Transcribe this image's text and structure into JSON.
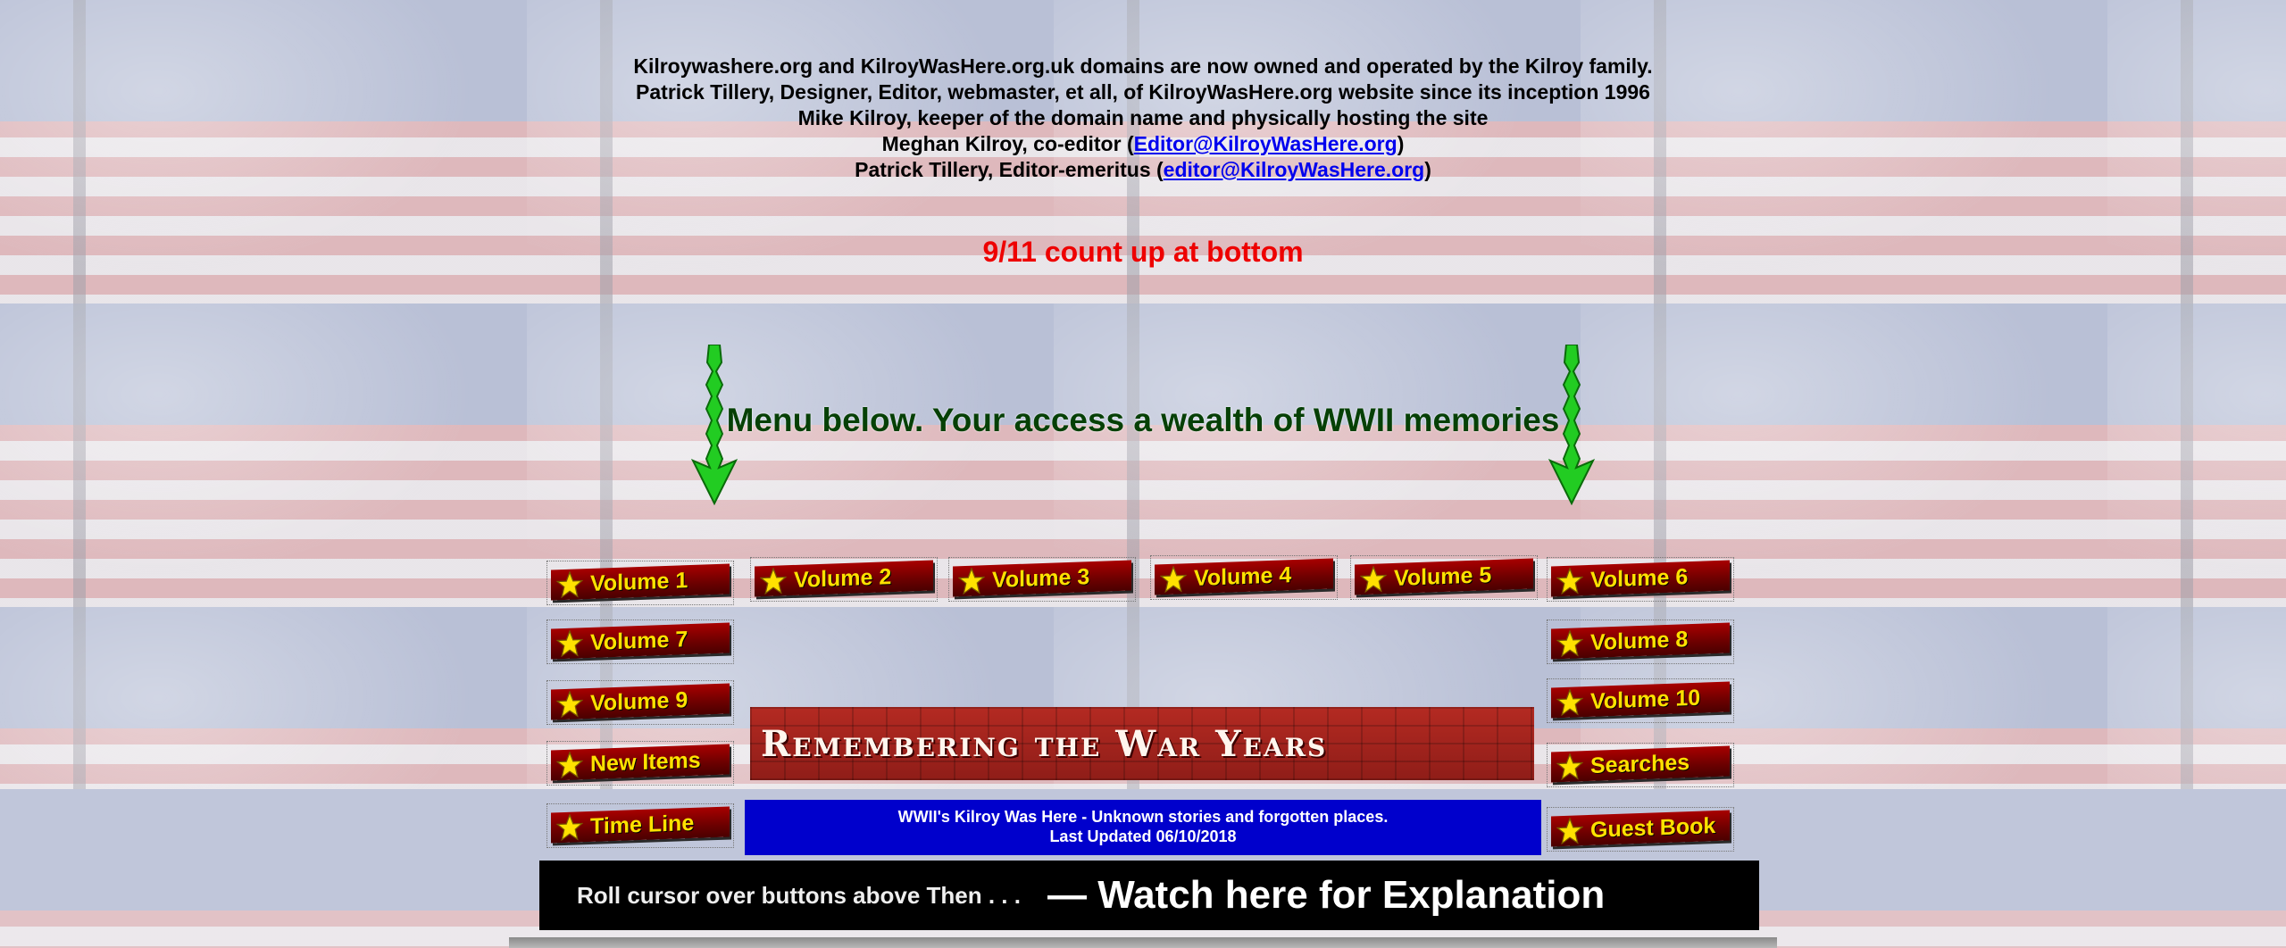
{
  "header": {
    "line1": "Kilroywashere.org and KilroyWasHere.org.uk domains are now owned and operated by the Kilroy family.",
    "line2": "Patrick Tillery, Designer, Editor, webmaster, et all, of KilroyWasHere.org website since its inception 1996",
    "line3": "Mike Kilroy, keeper of the domain name and physically hosting the site",
    "line4_prefix": "Meghan Kilroy, co-editor (",
    "line4_link": "Editor@KilroyWasHere.org",
    "line4_suffix": ")",
    "line5_prefix": "Patrick Tillery, Editor-emeritus (",
    "line5_link": "editor@KilroyWasHere.org",
    "line5_suffix": ")"
  },
  "countup_text": "9/11 count up at bottom",
  "menu_title": "Menu below. Your access a wealth of WWII memories",
  "buttons": {
    "volume1": "Volume 1",
    "volume2": "Volume 2",
    "volume3": "Volume 3",
    "volume4": "Volume 4",
    "volume5": "Volume 5",
    "volume6": "Volume 6",
    "volume7": "Volume 7",
    "volume8": "Volume 8",
    "volume9": "Volume 9",
    "volume10": "Volume 10",
    "new_items": "New Items",
    "searches": "Searches",
    "time_line": "Time Line",
    "guest_book": "Guest Book"
  },
  "banner_text": "Remembering the War Years",
  "update_box": {
    "line1": "WWII's Kilroy Was Here - Unknown stories and forgotten places.",
    "line2": "Last Updated 06/10/2018"
  },
  "explain_bar": {
    "hint": "Roll cursor over buttons above Then . . .",
    "watch": "— Watch here for Explanation"
  },
  "colors": {
    "button_face": "#8a0000",
    "button_text": "#ffe100",
    "countup": "#ee0000",
    "menu_title": "#064006",
    "update_box": "#0000cc",
    "arrow": "#22cc22"
  }
}
